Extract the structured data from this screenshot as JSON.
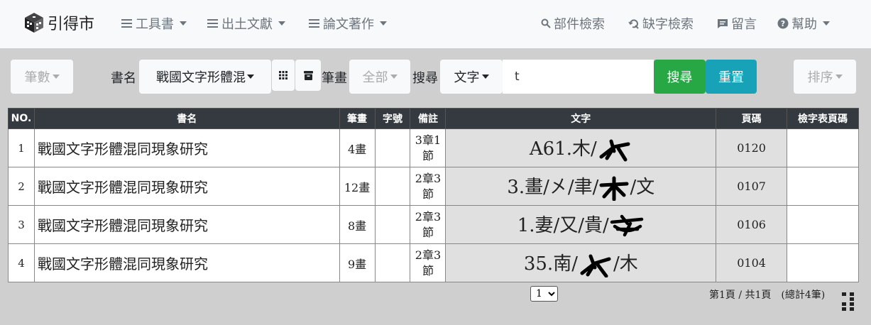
{
  "brand": {
    "name": "引得市"
  },
  "nav": {
    "left": [
      {
        "label": "工具書"
      },
      {
        "label": "出土文獻"
      },
      {
        "label": "論文著作"
      }
    ],
    "right": [
      {
        "label": "部件檢索",
        "icon": "search-icon"
      },
      {
        "label": "缺字檢索",
        "icon": "find-replace-icon"
      },
      {
        "label": "留言",
        "icon": "message-icon"
      },
      {
        "label": "幫助",
        "icon": "help-circle-icon"
      }
    ]
  },
  "search": {
    "stroke_button": "筆數",
    "book_label": "書名",
    "book_value": "戰國文字形體混",
    "strokes_label": "筆畫",
    "strokes_value": "全部",
    "search_label": "搜尋",
    "field_value": "文字",
    "query": "t",
    "search_button": "搜尋",
    "reset_button": "重置",
    "sort_button": "排序"
  },
  "table": {
    "headers": [
      "NO.",
      "書名",
      "筆畫",
      "字號",
      "備註",
      "文字",
      "頁碼",
      "檢字表頁碼"
    ],
    "rows": [
      {
        "no": "1",
        "book": "戰國文字形體混同現象研究",
        "strokes": "4畫",
        "char_no": "",
        "note": "3章1節",
        "chars_pre": "A61.木/",
        "chars_post": "",
        "page": "0120",
        "index_page": ""
      },
      {
        "no": "2",
        "book": "戰國文字形體混同現象研究",
        "strokes": "12畫",
        "char_no": "",
        "note": "2章3節",
        "chars_pre": "3.畫/㐅/聿/",
        "chars_post": "/文",
        "page": "0107",
        "index_page": ""
      },
      {
        "no": "3",
        "book": "戰國文字形體混同現象研究",
        "strokes": "8畫",
        "char_no": "",
        "note": "2章3節",
        "chars_pre": "1.妻/又/貴/",
        "chars_post": "",
        "page": "0106",
        "index_page": ""
      },
      {
        "no": "4",
        "book": "戰國文字形體混同現象研究",
        "strokes": "9畫",
        "char_no": "",
        "note": "2章3節",
        "chars_pre": "35.南/",
        "chars_post": "/木",
        "page": "0104",
        "index_page": ""
      }
    ]
  },
  "pagination": {
    "selected": "1",
    "info": "第1頁 / 共1頁　(總計4筆)"
  }
}
